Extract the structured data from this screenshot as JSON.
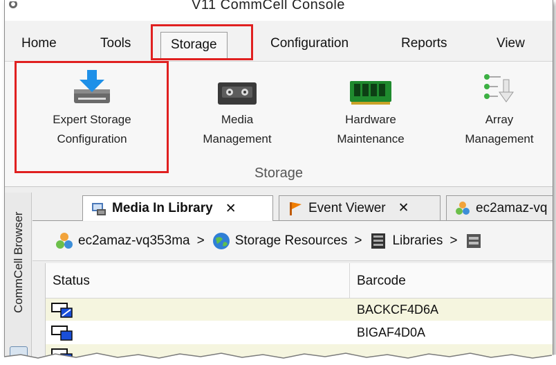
{
  "window": {
    "title": "V11 CommCell Console"
  },
  "menu": {
    "items": [
      {
        "label": "Home"
      },
      {
        "label": "Tools"
      },
      {
        "label": "Storage"
      },
      {
        "label": "Configuration"
      },
      {
        "label": "Reports"
      },
      {
        "label": "View"
      }
    ]
  },
  "ribbon": {
    "group_label": "Storage",
    "buttons": [
      {
        "line1": "Expert Storage",
        "line2": "Configuration",
        "icon": "storage-download-icon"
      },
      {
        "line1": "Media",
        "line2": "Management",
        "icon": "tape-cassette-icon"
      },
      {
        "line1": "Hardware",
        "line2": "Maintenance",
        "icon": "memory-board-icon"
      },
      {
        "line1": "Array",
        "line2": "Management",
        "icon": "array-arrow-icon"
      }
    ]
  },
  "sidebar": {
    "tab_label": "CommCell Browser"
  },
  "tabs": [
    {
      "label": "Media In Library",
      "active": true,
      "close": "✕"
    },
    {
      "label": "Event Viewer",
      "active": false,
      "close": "✕"
    },
    {
      "label": "ec2amaz-vq",
      "active": false
    }
  ],
  "breadcrumb": [
    {
      "label": "ec2amaz-vq353ma",
      "icon": "commcell-icon"
    },
    {
      "label": "Storage Resources",
      "icon": "globe-icon"
    },
    {
      "label": "Libraries",
      "icon": "library-icon"
    }
  ],
  "breadcrumb_sep": ">",
  "grid": {
    "columns": [
      "Status",
      "Barcode"
    ],
    "rows": [
      {
        "barcode": "BACKCF4D6A"
      },
      {
        "barcode": "BIGAF4D0A"
      },
      {
        "barcode": ""
      }
    ]
  },
  "colors": {
    "highlight": "#e02020",
    "row_tint": "#f5f5df",
    "accent_blue": "#1a6fd0"
  }
}
